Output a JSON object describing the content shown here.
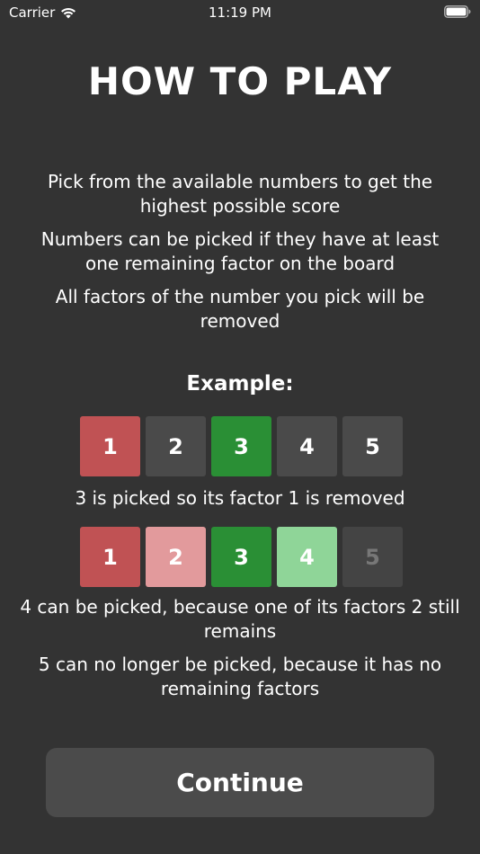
{
  "status_bar": {
    "carrier": "Carrier",
    "time": "11:19 PM"
  },
  "title": "HOW TO PLAY",
  "instructions": [
    "Pick from the available numbers to get the highest possible score",
    "Numbers can be picked if they have at least one remaining factor on the board",
    "All factors of the number you pick will be removed"
  ],
  "example": {
    "label": "Example:",
    "row1": [
      "1",
      "2",
      "3",
      "4",
      "5"
    ],
    "caption1": "3 is picked so its factor 1 is removed",
    "row2": [
      "1",
      "2",
      "3",
      "4",
      "5"
    ],
    "caption2": "4 can be picked, because one of its factors 2 still remains",
    "caption3": "5 can no longer be picked, because it has no remaining factors"
  },
  "continue_label": "Continue",
  "colors": {
    "background": "#333333",
    "removed_red": "#c05254",
    "available_grey": "#4a4a4a",
    "picked_green": "#2a8f35",
    "factor_pink": "#e29a9c",
    "pickable_lightgreen": "#8fd598"
  },
  "icons": [
    "wifi-icon",
    "battery-icon"
  ]
}
